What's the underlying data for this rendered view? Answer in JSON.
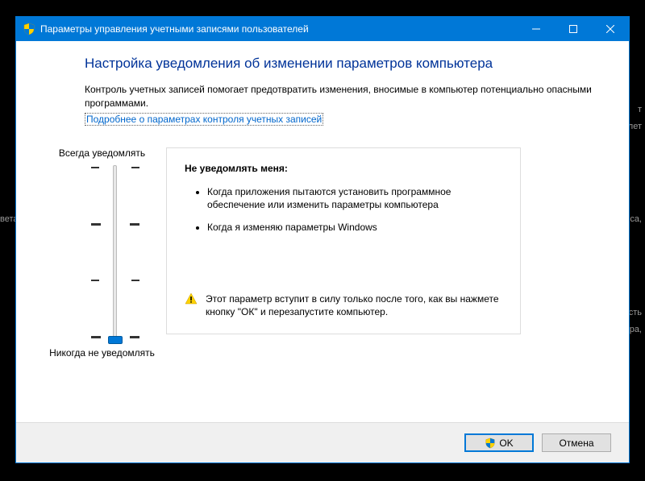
{
  "titlebar": {
    "title": "Параметры управления учетными записями пользователей"
  },
  "heading": "Настройка уведомления об изменении параметров компьютера",
  "description": "Контроль учетных записей помогает предотвратить изменения, вносимые в компьютер потенциально опасными программами.",
  "link_text": "Подробнее о параметрах контроля учетных записей",
  "slider": {
    "top_label": "Всегда уведомлять",
    "bottom_label": "Никогда не уведомлять",
    "level": 0,
    "levels": 4
  },
  "info": {
    "title": "Не уведомлять меня:",
    "items": [
      "Когда приложения пытаются установить программное обеспечение или изменить параметры компьютера",
      "Когда я изменяю параметры Windows"
    ],
    "warning": "Этот параметр вступит в силу только после того, как вы нажмете кнопку \"ОК\" и перезапустите компьютер."
  },
  "buttons": {
    "ok": "OK",
    "cancel": "Отмена"
  },
  "bg_fragments": {
    "a": "т",
    "b": "молет",
    "c": "вета",
    "d": "лоса,",
    "e": "льность",
    "f": "мера,"
  }
}
